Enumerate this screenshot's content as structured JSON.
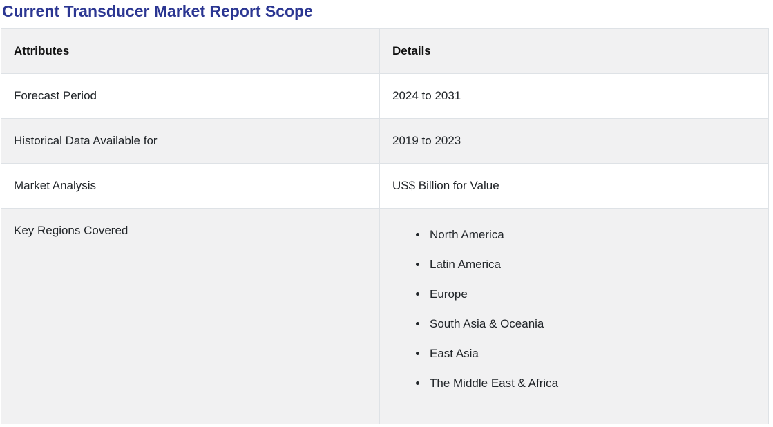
{
  "page": {
    "title": "Current Transducer Market Report Scope"
  },
  "colors": {
    "title_text": "#2b3692",
    "stripe_background": "#f1f1f2",
    "table_border": "#dee2e6",
    "body_text": "#212529"
  },
  "table": {
    "headers": [
      "Attributes",
      "Details"
    ],
    "rows": [
      {
        "attribute": "Forecast Period",
        "detail": "2024 to 2031"
      },
      {
        "attribute": "Historical Data Available for",
        "detail": "2019 to 2023"
      },
      {
        "attribute": "Market Analysis",
        "detail": "US$ Billion for Value"
      },
      {
        "attribute": "Key Regions Covered",
        "details": [
          "North America",
          "Latin America",
          "Europe",
          "South Asia & Oceania",
          "East Asia",
          "The Middle East & Africa"
        ]
      }
    ]
  }
}
